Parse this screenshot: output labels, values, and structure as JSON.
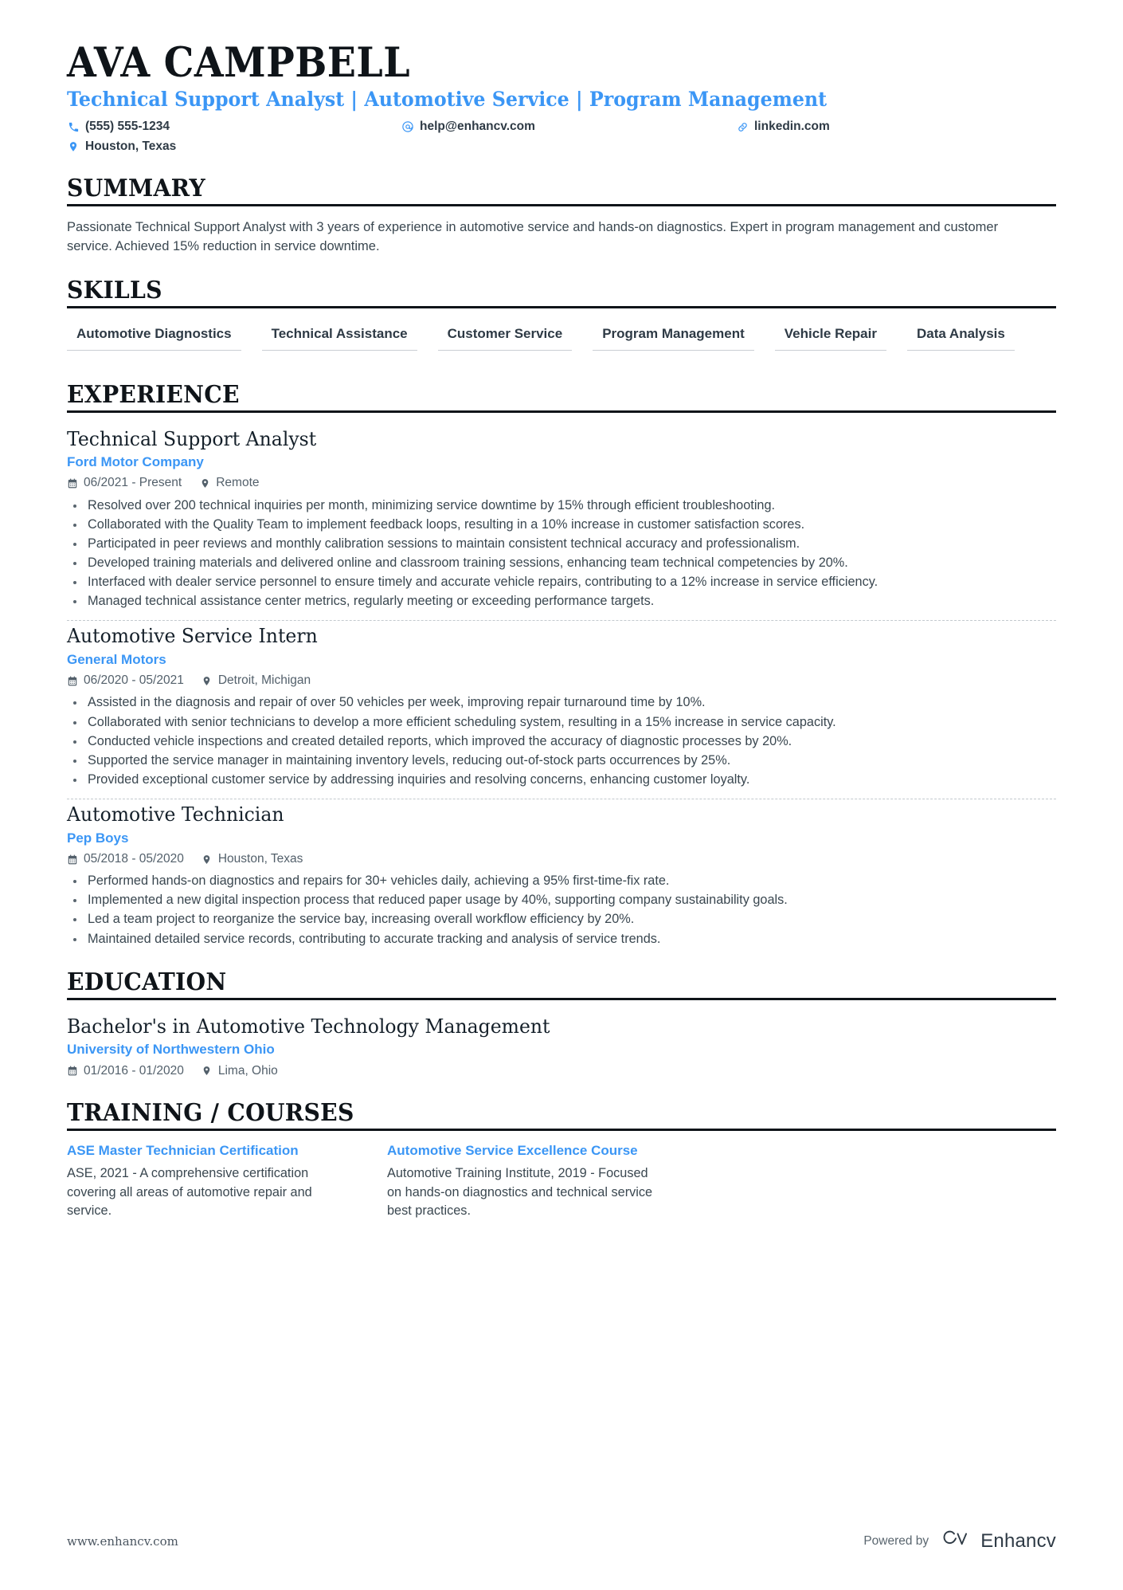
{
  "header": {
    "name": "AVA CAMPBELL",
    "headline": "Technical Support Analyst | Automotive Service | Program Management",
    "contacts": [
      {
        "icon": "phone-icon",
        "text": "(555) 555-1234"
      },
      {
        "icon": "email-icon",
        "text": "help@enhancv.com"
      },
      {
        "icon": "link-icon",
        "text": "linkedin.com"
      },
      {
        "icon": "location-icon",
        "text": "Houston, Texas"
      }
    ]
  },
  "sections": {
    "summary": {
      "title": "SUMMARY",
      "text": "Passionate Technical Support Analyst with 3 years of experience in automotive service and hands-on diagnostics. Expert in program management and customer service. Achieved 15% reduction in service downtime."
    },
    "skills": {
      "title": "SKILLS",
      "items": [
        "Automotive Diagnostics",
        "Technical Assistance",
        "Customer Service",
        "Program Management",
        "Vehicle Repair",
        "Data Analysis"
      ]
    },
    "experience": {
      "title": "EXPERIENCE",
      "entries": [
        {
          "role": "Technical Support Analyst",
          "company": "Ford Motor Company",
          "dates": "06/2021 - Present",
          "location": "Remote",
          "bullets": [
            "Resolved over 200 technical inquiries per month, minimizing service downtime by 15% through efficient troubleshooting.",
            "Collaborated with the Quality Team to implement feedback loops, resulting in a 10% increase in customer satisfaction scores.",
            "Participated in peer reviews and monthly calibration sessions to maintain consistent technical accuracy and professionalism.",
            "Developed training materials and delivered online and classroom training sessions, enhancing team technical competencies by 20%.",
            "Interfaced with dealer service personnel to ensure timely and accurate vehicle repairs, contributing to a 12% increase in service efficiency.",
            "Managed technical assistance center metrics, regularly meeting or exceeding performance targets."
          ]
        },
        {
          "role": "Automotive Service Intern",
          "company": "General Motors",
          "dates": "06/2020 - 05/2021",
          "location": "Detroit, Michigan",
          "bullets": [
            "Assisted in the diagnosis and repair of over 50 vehicles per week, improving repair turnaround time by 10%.",
            "Collaborated with senior technicians to develop a more efficient scheduling system, resulting in a 15% increase in service capacity.",
            "Conducted vehicle inspections and created detailed reports, which improved the accuracy of diagnostic processes by 20%.",
            "Supported the service manager in maintaining inventory levels, reducing out-of-stock parts occurrences by 25%.",
            "Provided exceptional customer service by addressing inquiries and resolving concerns, enhancing customer loyalty."
          ]
        },
        {
          "role": "Automotive Technician",
          "company": "Pep Boys",
          "dates": "05/2018 - 05/2020",
          "location": "Houston, Texas",
          "bullets": [
            "Performed hands-on diagnostics and repairs for 30+ vehicles daily, achieving a 95% first-time-fix rate.",
            "Implemented a new digital inspection process that reduced paper usage by 40%, supporting company sustainability goals.",
            "Led a team project to reorganize the service bay, increasing overall workflow efficiency by 20%.",
            "Maintained detailed service records, contributing to accurate tracking and analysis of service trends."
          ]
        }
      ]
    },
    "education": {
      "title": "EDUCATION",
      "entries": [
        {
          "degree": "Bachelor's in Automotive Technology Management",
          "school": "University of Northwestern Ohio",
          "dates": "01/2016 - 01/2020",
          "location": "Lima, Ohio"
        }
      ]
    },
    "training": {
      "title": "TRAINING / COURSES",
      "courses": [
        {
          "name": "ASE Master Technician Certification",
          "description": "ASE, 2021 - A comprehensive certification covering all areas of automotive repair and service."
        },
        {
          "name": "Automotive Service Excellence Course",
          "description": "Automotive Training Institute, 2019 - Focused on hands-on diagnostics and technical service best practices."
        }
      ]
    }
  },
  "footer": {
    "url": "www.enhancv.com",
    "powered_by": "Powered by",
    "brand": "Enhancv"
  },
  "colors": {
    "accent": "#3b96f5",
    "text": "#3a4750",
    "heading": "#0f1419"
  }
}
